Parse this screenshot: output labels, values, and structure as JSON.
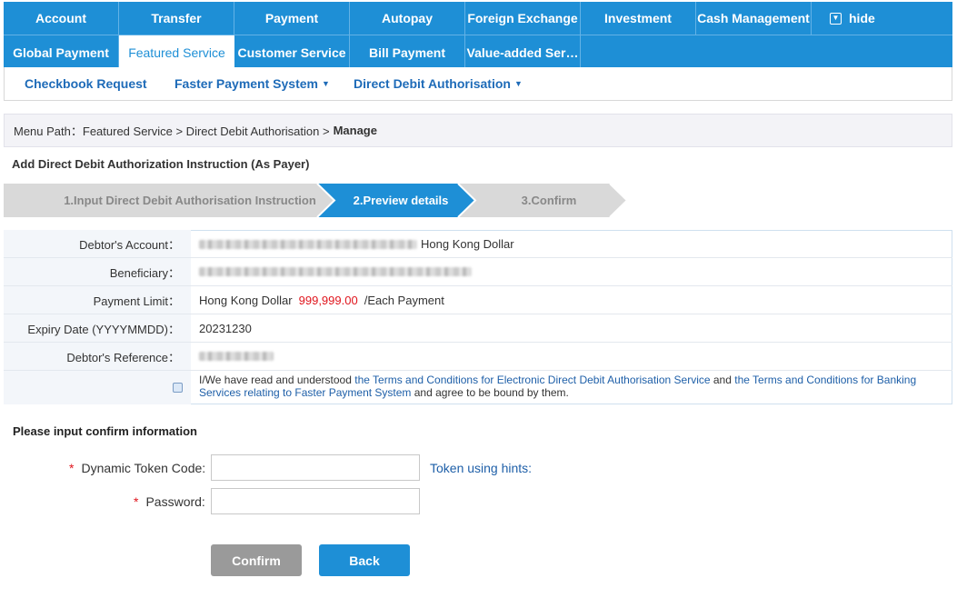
{
  "nav": {
    "row1": [
      "Account",
      "Transfer",
      "Payment",
      "Autopay",
      "Foreign Exchange",
      "Investment",
      "Cash Management"
    ],
    "hide_label": "hide",
    "row2": [
      "Global Payment",
      "Featured Service",
      "Customer Service",
      "Bill Payment",
      "Value-added Ser…"
    ],
    "active": "Featured Service"
  },
  "subnav": {
    "items": [
      "Checkbook Request",
      "Faster Payment System",
      "Direct Debit Authorisation"
    ]
  },
  "breadcrumb": {
    "prefix": "Menu Path：Featured Service > Direct Debit Authorisation >",
    "current": "Manage"
  },
  "page_title": "Add Direct Debit Authorization Instruction (As Payer)",
  "steps": [
    "1.Input Direct Debit Authorisation Instruction",
    "2.Preview details",
    "3.Confirm"
  ],
  "details": {
    "debtor_account_label": "Debtor's Account：",
    "debtor_account_currency": "Hong Kong Dollar",
    "beneficiary_label": "Beneficiary：",
    "payment_limit_label": "Payment Limit：",
    "payment_limit_currency": "Hong Kong Dollar",
    "payment_limit_amount": "999,999.00",
    "payment_limit_suffix": "/Each Payment",
    "expiry_label": "Expiry Date (YYYYMMDD)：",
    "expiry_value": "20231230",
    "reference_label": "Debtor's Reference："
  },
  "agreement": {
    "text1": "I/We have read and understood ",
    "link1": "the Terms and Conditions for Electronic Direct Debit Authorisation Service",
    "text2": " and ",
    "link2": "the Terms and Conditions for Banking Services relating to Faster Payment System",
    "text3": " and agree to be bound by them."
  },
  "confirm": {
    "title": "Please input confirm information",
    "token_label": "Dynamic Token Code:",
    "token_hint": "Token using hints:",
    "password_label": "Password:",
    "required_mark": "*"
  },
  "buttons": {
    "confirm": "Confirm",
    "back": "Back"
  },
  "colors": {
    "primary": "#1e8fd6",
    "step_active": "#1e8fd6",
    "step_inactive": "#d9d9d9",
    "amount_red": "#e0151d"
  }
}
